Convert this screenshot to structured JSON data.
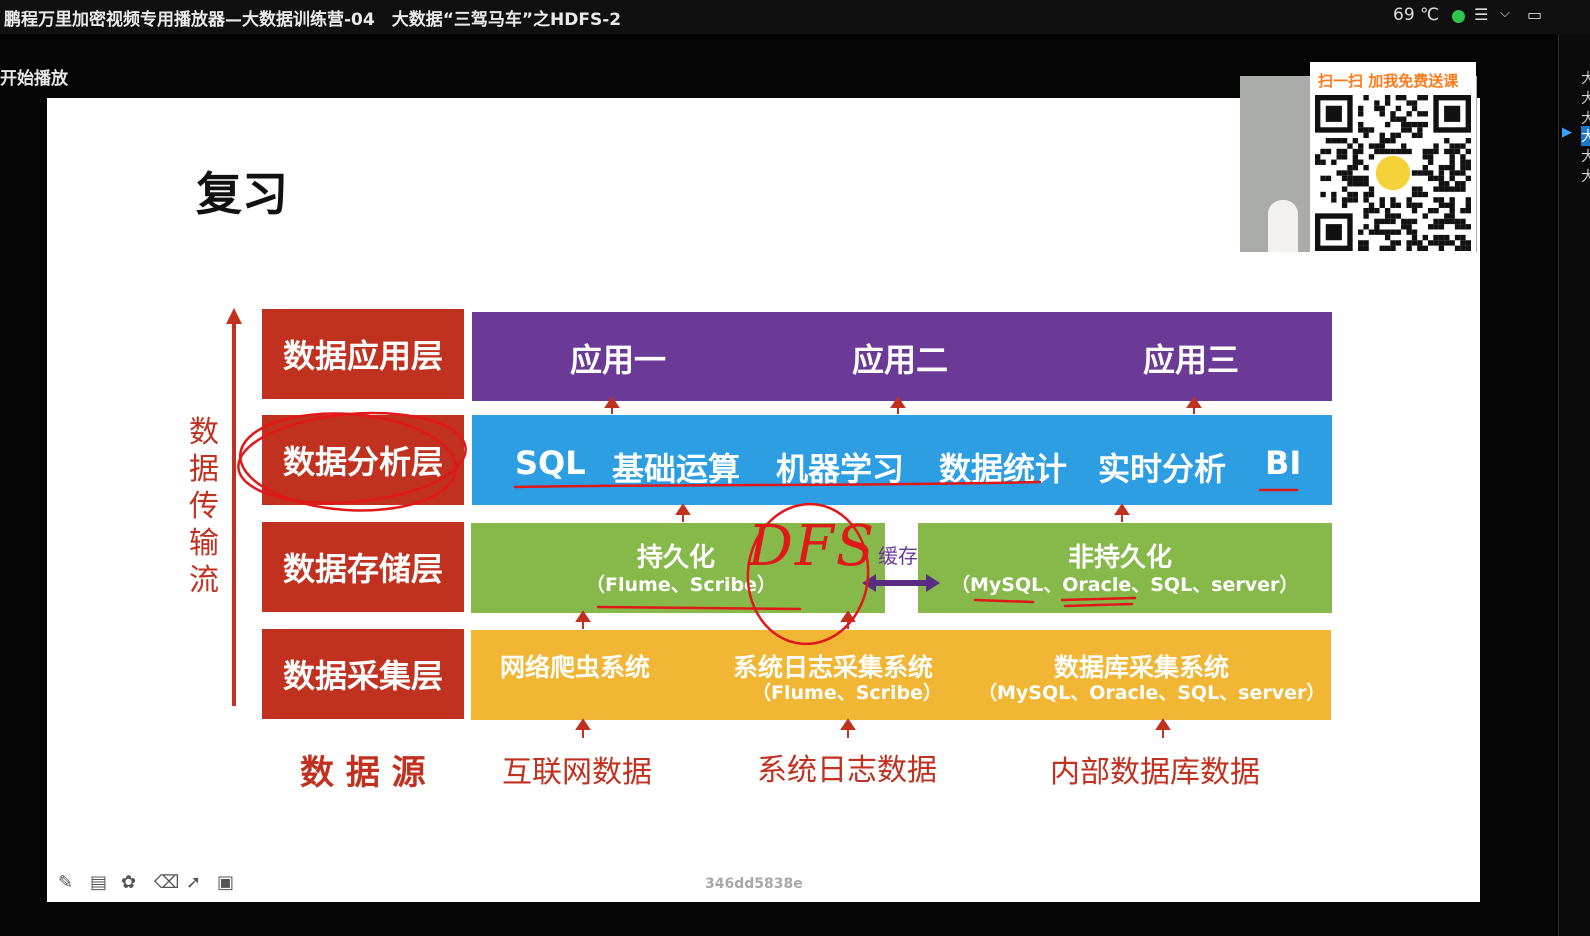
{
  "window": {
    "title": "鹏程万里加密视频专用播放器—大数据训练营-04　大数据“三驾马车”之HDFS-2",
    "temperature": "69 ℃",
    "status_color": "#2fc54a",
    "icons": [
      "list-icon",
      "chevron-down-icon",
      "monitor-icon",
      "playlist-icon"
    ]
  },
  "player": {
    "status_text": "开始播放"
  },
  "playlist": {
    "items": [
      "大",
      "大",
      "大",
      "大",
      "大",
      "大"
    ],
    "active_index": 3
  },
  "overlay": {
    "qr_caption": "扫一扫 加我免费送课"
  },
  "slide": {
    "title": "复习",
    "flow_label": "数据传输流",
    "layers": [
      "数据应用层",
      "数据分析层",
      "数据存储层",
      "数据采集层"
    ],
    "source_label": "数 据 源",
    "application": [
      "应用一",
      "应用二",
      "应用三"
    ],
    "analysis": [
      "SQL",
      "基础运算",
      "机器学习",
      "数据统计",
      "实时分析",
      "BI"
    ],
    "storage": {
      "persistent_title": "持久化",
      "persistent_sub": "（Flume、Scribe）",
      "cache_label": "缓存",
      "nonpersistent_title": "非持久化",
      "nonpersistent_sub": "（MySQL、Oracle、SQL、server）"
    },
    "collection": {
      "crawler": "网络爬虫系统",
      "log_title": "系统日志采集系统",
      "log_sub": "（Flume、Scribe）",
      "db_title": "数据库采集系统",
      "db_sub": "（MySQL、Oracle、SQL、server）"
    },
    "sources": [
      "互联网数据",
      "系统日志数据",
      "内部数据库数据"
    ],
    "handwriting": "DFS",
    "colors": {
      "label_red": "#c0311f",
      "app_purple": "#6b3a96",
      "analysis_blue": "#2d9ee2",
      "storage_green": "#86b84a",
      "collection_yellow": "#f0b634",
      "annotation_red": "#e0181a"
    }
  },
  "toolbar": {
    "tools": [
      "pen-icon",
      "whiteboard-icon",
      "palette-icon",
      "eraser-icon",
      "pointer-icon",
      "screen-icon"
    ],
    "watermark": "346dd5838e"
  }
}
